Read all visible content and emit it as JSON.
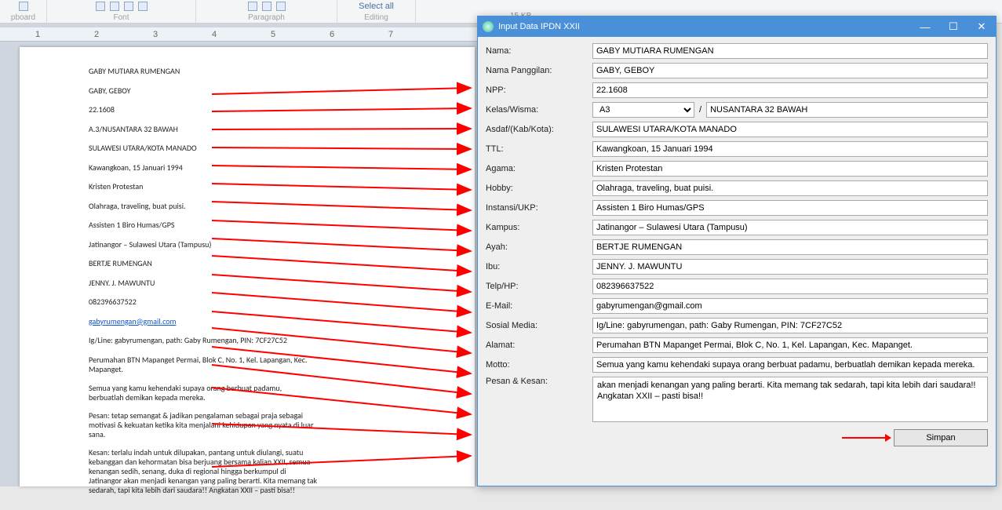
{
  "ribbon": {
    "group1": "pboard",
    "group2": "Font",
    "group3": "Paragraph",
    "group4": "Editing",
    "selectall": "Select all"
  },
  "sizebadge": "15 KB",
  "ruler_marks": [
    "1",
    "2",
    "3",
    "4",
    "5",
    "6",
    "7"
  ],
  "doc": [
    {
      "t": "GABY MUTIARA RUMENGAN",
      "cls": ""
    },
    {
      "t": "GABY, GEBOY",
      "cls": ""
    },
    {
      "t": "22.1608",
      "cls": ""
    },
    {
      "t": "A.3/NUSANTARA 32 BAWAH",
      "cls": ""
    },
    {
      "t": "SULAWESI UTARA/KOTA MANADO",
      "cls": ""
    },
    {
      "t": "Kawangkoan, 15 Januari 1994",
      "cls": ""
    },
    {
      "t": "Kristen Protestan",
      "cls": ""
    },
    {
      "t": "Olahraga, traveling, buat puisi.",
      "cls": ""
    },
    {
      "t": "Assisten 1 Biro Humas/GPS",
      "cls": ""
    },
    {
      "t": "Jatinangor – Sulawesi Utara (Tampusu)",
      "cls": ""
    },
    {
      "t": "BERTJE RUMENGAN",
      "cls": ""
    },
    {
      "t": "JENNY. J. MAWUNTU",
      "cls": ""
    },
    {
      "t": "082396637522",
      "cls": ""
    },
    {
      "t": "gabyrumengan@gmail.com",
      "cls": "link"
    },
    {
      "t": "Ig/Line: gabyrumengan, path: Gaby Rumengan, PIN: 7CF27C52",
      "cls": ""
    },
    {
      "t": "Perumahan BTN Mapanget Permai, Blok C, No. 1, Kel. Lapangan, Kec. Mapanget.",
      "cls": ""
    },
    {
      "t": "Semua yang kamu kehendaki supaya orang berbuat padamu, berbuatlah demikan kepada mereka.",
      "cls": "para"
    },
    {
      "t": "Pesan: tetap semangat & jadikan pengalaman sebagai praja sebagai motivasi & kekuatan ketika kita menjalani kehidupan yang nyata di luar sana.",
      "cls": "para"
    },
    {
      "t": "Kesan: terlalu indah untuk dilupakan, pantang untuk diulangi, suatu kebanggan dan kehormatan bisa berjuang bersama kalian XXII, semua kenangan sedih, senang, duka di regional hingga berkumpul di Jatinangor akan menjadi kenangan yang paling berarti. Kita memang tak sedarah, tapi kita lebih dari saudara!!  Angkatan XXII – pasti bisa!!",
      "cls": "para"
    }
  ],
  "dialog": {
    "title": "Input Data IPDN XXII",
    "labels": {
      "nama": "Nama:",
      "panggilan": "Nama Panggilan:",
      "npp": "NPP:",
      "kelas": "Kelas/Wisma:",
      "asdaf": "Asdaf/(Kab/Kota):",
      "ttl": "TTL:",
      "agama": "Agama:",
      "hobby": "Hobby:",
      "instansi": "Instansi/UKP:",
      "kampus": "Kampus:",
      "ayah": "Ayah:",
      "ibu": "Ibu:",
      "telp": "Telp/HP:",
      "email": "E-Mail:",
      "sosmed": "Sosial Media:",
      "alamat": "Alamat:",
      "motto": "Motto:",
      "pesan": "Pesan & Kesan:"
    },
    "slash": "/",
    "values": {
      "nama": "GABY MUTIARA RUMENGAN",
      "panggilan": "GABY, GEBOY",
      "npp": "22.1608",
      "kelas_sel": "A3",
      "kelas_txt": "NUSANTARA 32 BAWAH",
      "asdaf": "SULAWESI UTARA/KOTA MANADO",
      "ttl": "Kawangkoan, 15 Januari 1994",
      "agama": "Kristen Protestan",
      "hobby": "Olahraga, traveling, buat puisi.",
      "instansi": "Assisten 1 Biro Humas/GPS",
      "kampus": "Jatinangor – Sulawesi Utara (Tampusu)",
      "ayah": "BERTJE RUMENGAN",
      "ibu": "JENNY. J. MAWUNTU",
      "telp": "082396637522",
      "email": "gabyrumengan@gmail.com",
      "sosmed": "Ig/Line: gabyrumengan, path: Gaby Rumengan, PIN: 7CF27C52",
      "alamat": "Perumahan BTN Mapanget Permai, Blok C, No. 1, Kel. Lapangan, Kec. Mapanget.",
      "motto": "Semua yang kamu kehendaki supaya orang berbuat padamu, berbuatlah demikan kepada mereka.",
      "pesan": "akan menjadi kenangan yang paling berarti. Kita memang tak sedarah, tapi kita lebih dari saudara!!  Angkatan XXII – pasti bisa!!"
    },
    "simpan": "Simpan"
  },
  "arrows_from_y": [
    60,
    82,
    105,
    128,
    151,
    174,
    197,
    221,
    244,
    266,
    290,
    313,
    337,
    358,
    382,
    405,
    434,
    480,
    535
  ],
  "arrows_to_y": [
    52,
    78,
    104,
    130,
    156,
    182,
    208,
    234,
    260,
    286,
    312,
    338,
    364,
    390,
    416,
    442,
    468,
    494,
    521
  ]
}
